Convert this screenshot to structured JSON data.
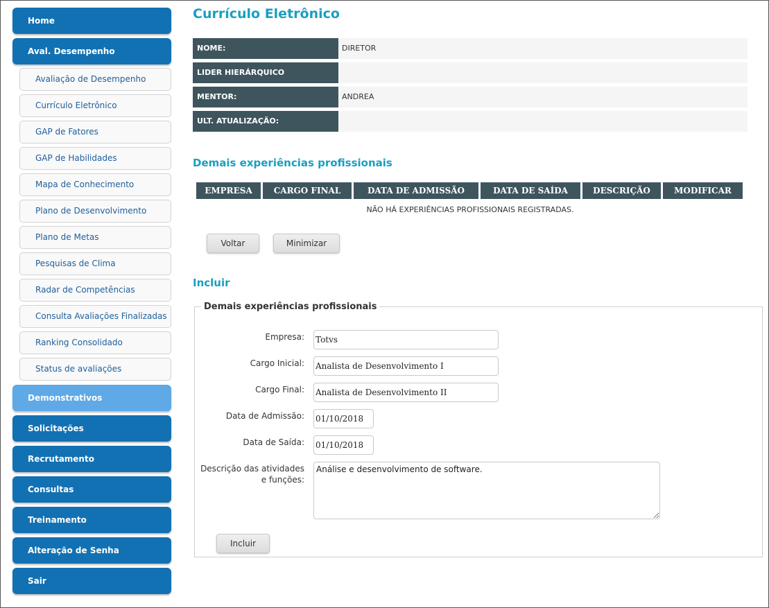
{
  "sidebar": {
    "main_top": [
      {
        "label": "Home"
      },
      {
        "label": "Aval. Desempenho"
      }
    ],
    "sub_items": [
      {
        "label": "Avaliação de Desempenho"
      },
      {
        "label": "Currículo Eletrônico"
      },
      {
        "label": "GAP de Fatores"
      },
      {
        "label": "GAP de Habilidades"
      },
      {
        "label": "Mapa de Conhecimento"
      },
      {
        "label": "Plano de Desenvolvimento"
      },
      {
        "label": "Plano de Metas"
      },
      {
        "label": "Pesquisas de Clima"
      },
      {
        "label": "Radar de Competências"
      },
      {
        "label": "Consulta Avaliações Finalizadas"
      },
      {
        "label": "Ranking Consolidado"
      },
      {
        "label": "Status de avaliações"
      }
    ],
    "main_bottom": [
      {
        "label": "Demonstrativos"
      },
      {
        "label": "Solicitações"
      },
      {
        "label": "Recrutamento"
      },
      {
        "label": "Consultas"
      },
      {
        "label": "Treinamento"
      },
      {
        "label": "Alteração de Senha"
      },
      {
        "label": "Sair"
      }
    ]
  },
  "page": {
    "title": "Currículo Eletrônico",
    "info": [
      {
        "label": "NOME:",
        "value": "DIRETOR"
      },
      {
        "label": "LIDER HIERÁRQUICO",
        "value": ""
      },
      {
        "label": "MENTOR:",
        "value": "ANDREA"
      },
      {
        "label": "ULT. ATUALIZAÇÃO:",
        "value": ""
      }
    ],
    "experiences": {
      "title": "Demais experiências profissionais",
      "columns": [
        "EMPRESA",
        "CARGO FINAL",
        "DATA DE ADMISSÃO",
        "DATA DE SAÍDA",
        "DESCRIÇÃO",
        "MODIFICAR"
      ],
      "empty_message": "NÃO HÁ EXPERIÊNCIAS PROFISSIONAIS REGISTRADAS."
    },
    "buttons": {
      "back": "Voltar",
      "minimize": "Minimizar"
    },
    "include": {
      "title": "Incluir",
      "legend": "Demais experiências profissionais",
      "fields": {
        "empresa": {
          "label": "Empresa:",
          "value": "Totvs"
        },
        "cargo_inicial": {
          "label": "Cargo Inicial:",
          "value": "Analista de Desenvolvimento I"
        },
        "cargo_final": {
          "label": "Cargo Final:",
          "value": "Analista de Desenvolvimento II"
        },
        "data_admissao": {
          "label": "Data de Admissão:",
          "value": "01/10/2018"
        },
        "data_saida": {
          "label": "Data de Saída:",
          "value": "01/10/2018"
        },
        "descricao": {
          "label_line1": "Descrição das atividades",
          "label_line2": "e funções:",
          "value": "Análise e desenvolvimento de software."
        }
      },
      "submit": "Incluir"
    }
  },
  "colors": {
    "nav_primary": "#1271b2",
    "nav_highlight": "#5fa9e6",
    "header_dark": "#3e555e",
    "title_accent": "#1b9ec1"
  }
}
